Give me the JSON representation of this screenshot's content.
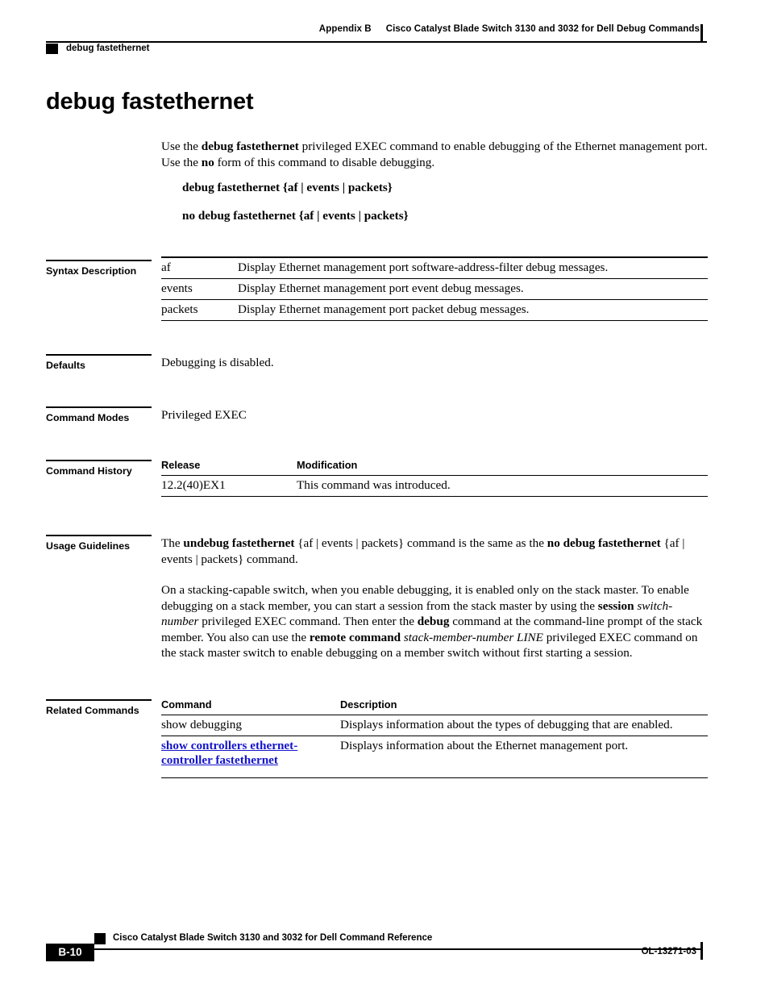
{
  "header": {
    "appendix": "Appendix B",
    "book_title": "Cisco Catalyst Blade Switch 3130 and 3032 for Dell Debug Commands",
    "running_head": "debug fastethernet"
  },
  "title": "debug fastethernet",
  "intro": {
    "part1": "Use the ",
    "cmd1": "debug fastethernet",
    "part2": " privileged EXEC command to enable debugging of the Ethernet management port. Use the ",
    "cmd2": "no",
    "part3": " form of this command to disable debugging."
  },
  "syntax_lines": [
    {
      "bold_head": "debug fastethernet",
      "args": " {af | events | packets}"
    },
    {
      "bold_head": "no debug fastethernet",
      "args": " {af | events | packets}"
    }
  ],
  "syntax_description": {
    "label": "Syntax Description",
    "rows": [
      {
        "term": "af",
        "description": "Display Ethernet management port software-address-filter debug messages."
      },
      {
        "term": "events",
        "description": "Display Ethernet management port event debug messages."
      },
      {
        "term": "packets",
        "description": "Display Ethernet management port packet debug messages."
      }
    ]
  },
  "defaults": {
    "label": "Defaults",
    "text": "Debugging is disabled."
  },
  "command_modes": {
    "label": "Command Modes",
    "text": "Privileged EXEC"
  },
  "command_history": {
    "label": "Command History",
    "columns": [
      "Release",
      "Modification"
    ],
    "rows": [
      {
        "release": "12.2(40)EX1",
        "modification": "This command was introduced."
      }
    ]
  },
  "usage_guidelines": {
    "label": "Usage Guidelines",
    "p1": {
      "a": "The ",
      "b1": "undebug fastethernet",
      "b": " {af | events | packets} command is the same as the ",
      "b2": "no debug fastethernet",
      "c": " {af | events | packets} command."
    },
    "p2": {
      "a": "On a stacking-capable switch, when you enable debugging, it is enabled only on the stack master. To enable debugging on a stack member, you can start a session from the stack master by using the ",
      "b1": "session",
      "i1": " switch-number",
      "b": " privileged EXEC command. Then enter the ",
      "b2": "debug",
      "c": " command at the command-line prompt of the stack member. You also can use the ",
      "b3": "remote command",
      "i2": " stack-member-number LINE",
      "d": " privileged EXEC command on the stack master switch to enable debugging on a member switch without first starting a session."
    }
  },
  "related_commands": {
    "label": "Related Commands",
    "columns": [
      "Command",
      "Description"
    ],
    "rows": [
      {
        "command": "show debugging",
        "is_link": false,
        "description": "Displays information about the types of debugging that are enabled."
      },
      {
        "command": "show controllers ethernet-controller fastethernet",
        "is_link": true,
        "description": "Displays information about the Ethernet management port."
      }
    ],
    "link_color": "#1414cc"
  },
  "footer": {
    "page_number": "B-10",
    "doc_title": "Cisco Catalyst Blade Switch 3130 and 3032 for Dell Command Reference",
    "doc_number": "OL-13271-03"
  }
}
